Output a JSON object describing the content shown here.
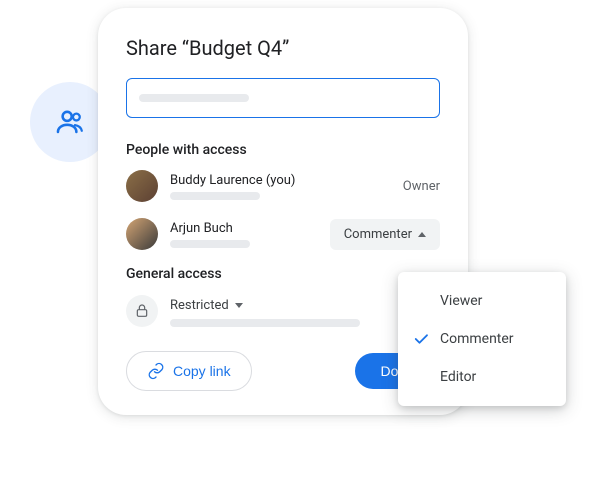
{
  "dialog": {
    "title": "Share “Budget Q4”",
    "sections": {
      "people_heading": "People with access",
      "general_heading": "General access"
    },
    "people": [
      {
        "name": "Buddy Laurence (you)",
        "role": "Owner"
      },
      {
        "name": "Arjun Buch",
        "role": "Commenter"
      }
    ],
    "general_access": {
      "level": "Restricted"
    },
    "actions": {
      "copy_link": "Copy link",
      "done": "Done"
    }
  },
  "role_menu": {
    "options": [
      "Viewer",
      "Commenter",
      "Editor"
    ],
    "selected": "Commenter"
  }
}
